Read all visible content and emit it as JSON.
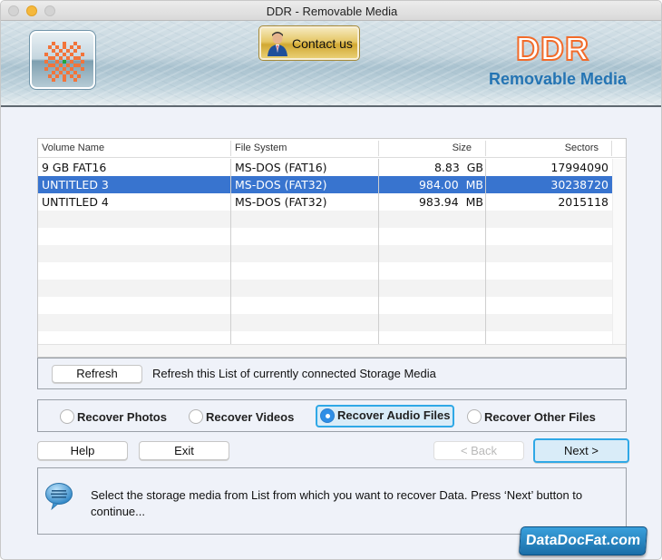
{
  "window": {
    "title": "DDR - Removable Media"
  },
  "banner": {
    "contact_label": "Contact us",
    "brand_title": "DDR",
    "brand_subtitle": "Removable Media",
    "brand_color": "#f26b2a",
    "subtitle_color": "#2474b3"
  },
  "table": {
    "columns": [
      "Volume Name",
      "File System",
      "Size",
      "Sectors"
    ],
    "rows": [
      {
        "volume": "9 GB FAT16",
        "fs": "MS-DOS (FAT16)",
        "size": "8.83  GB",
        "sectors": "17994090",
        "selected": false
      },
      {
        "volume": "UNTITLED 3",
        "fs": "MS-DOS (FAT32)",
        "size": "984.00  MB",
        "sectors": "30238720",
        "selected": true
      },
      {
        "volume": "UNTITLED 4",
        "fs": "MS-DOS (FAT32)",
        "size": "983.94  MB",
        "sectors": "2015118",
        "selected": false
      }
    ],
    "selection_color": "#3874cf"
  },
  "refresh": {
    "button_label": "Refresh",
    "description": "Refresh this List of currently connected Storage Media"
  },
  "recovery_options": [
    {
      "label": "Recover Photos",
      "checked": false
    },
    {
      "label": "Recover Videos",
      "checked": false
    },
    {
      "label": "Recover Audio Files",
      "checked": true
    },
    {
      "label": "Recover Other Files",
      "checked": false
    }
  ],
  "buttons": {
    "help": "Help",
    "exit": "Exit",
    "back": "< Back",
    "next": "Next >"
  },
  "message": {
    "icon": "speech-bubble-icon",
    "text": "Select the storage media from List from which you want to recover Data. Press ‘Next’ button to continue..."
  },
  "watermark": "DataDocFat.com"
}
